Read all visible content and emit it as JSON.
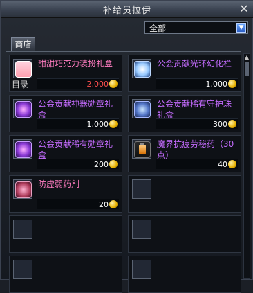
{
  "window": {
    "title": "补给员拉伊",
    "close_label": "✕"
  },
  "filter": {
    "selected": "全部"
  },
  "tabs": [
    {
      "label": "商店"
    }
  ],
  "items": [
    {
      "name": "甜甜巧克力装扮礼盒",
      "price": "2,000",
      "price_color": "red",
      "icon": "gift-box-icon",
      "badge": "目录"
    },
    {
      "name": "公会贡献光环幻化栏",
      "price": "1,000",
      "icon": "ring-orb-icon"
    },
    {
      "name": "公会贡献神器勋章礼盒",
      "price": "1,000",
      "icon": "purple-medal-icon"
    },
    {
      "name": "公会贡献稀有守护珠礼盒",
      "price": "300",
      "icon": "guardian-orb-icon"
    },
    {
      "name": "公会贡献稀有勋章礼盒",
      "price": "200",
      "icon": "rare-medal-icon"
    },
    {
      "name": "魔界抗疲劳秘药（30点）",
      "price": "40",
      "icon": "potion-icon"
    },
    {
      "name": "防虚弱药剂",
      "price": "20",
      "icon": "flask-icon"
    }
  ]
}
